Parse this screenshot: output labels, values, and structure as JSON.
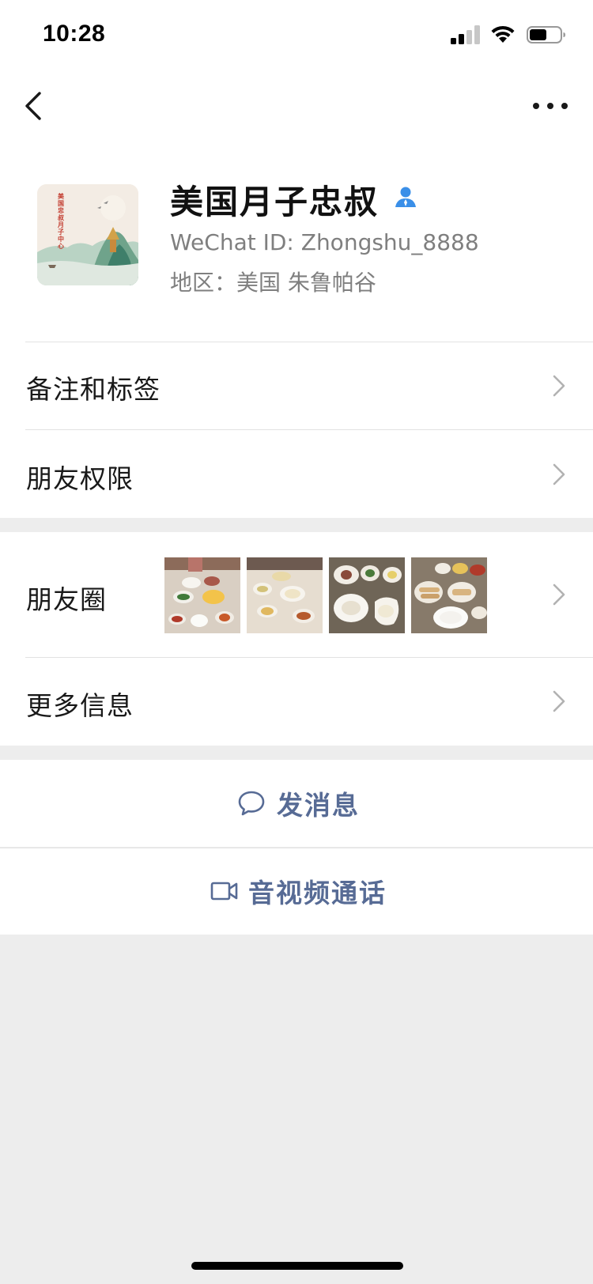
{
  "status_bar": {
    "time": "10:28",
    "signal_icon": "cellular-signal-icon",
    "wifi_icon": "wifi-icon",
    "battery_icon": "battery-icon"
  },
  "nav": {
    "back_icon": "chevron-left-icon",
    "more_icon": "more-dots-icon"
  },
  "profile": {
    "name": "美国月子忠叔",
    "wechat_id": "WeChat ID: Zhongshu_8888",
    "region": "地区：美国 朱鲁帕谷",
    "avatar_caption": "美国忠叔月子中心",
    "verified_icon": "person-icon"
  },
  "menu": {
    "remarks_tags": "备注和标签",
    "friend_permissions": "朋友权限",
    "moments": "朋友圈",
    "more_info": "更多信息"
  },
  "moments_thumbs": [
    {
      "name": "moments-photo-1"
    },
    {
      "name": "moments-photo-2"
    },
    {
      "name": "moments-photo-3"
    },
    {
      "name": "moments-photo-4"
    }
  ],
  "actions": {
    "send_message": "发消息",
    "video_call": "音视频通话"
  },
  "colors": {
    "accent_link": "#576b95",
    "page_background": "#ededed",
    "card_background": "#ffffff",
    "secondary_text": "#7f7f7f",
    "verified_blue": "#3a8fe8"
  }
}
